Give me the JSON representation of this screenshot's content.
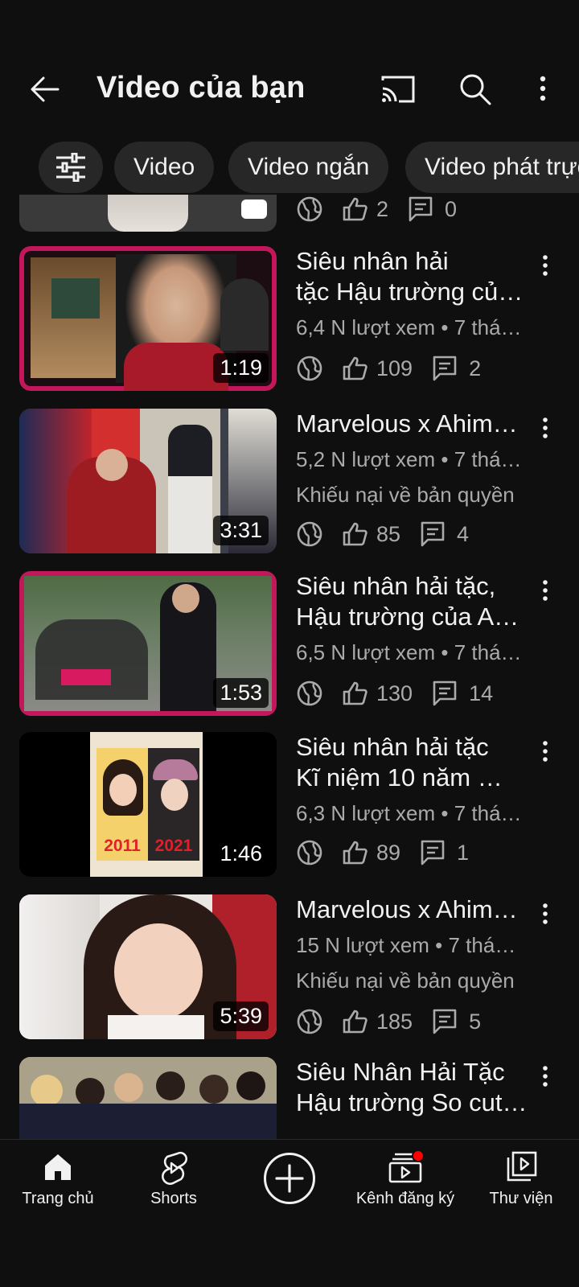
{
  "header": {
    "title": "Video của bạn",
    "back_icon": "arrow-left-icon",
    "cast_icon": "cast-icon",
    "search_icon": "search-icon",
    "more_icon": "more-vert-icon"
  },
  "filters": {
    "filter_icon": "tune-icon",
    "chips": [
      "Video",
      "Video ngắn",
      "Video phát trực tiếp"
    ]
  },
  "partial_row": {
    "likes": "2",
    "comments": "0"
  },
  "videos": [
    {
      "title_line1": "Siêu nhân hải",
      "title_line2": "tặc Hậu trường củ…",
      "meta": "6,4 N lượt xem • 7 thá…",
      "claim": "",
      "duration": "1:19",
      "likes": "109",
      "comments": "2"
    },
    {
      "title_line1": "Marvelous x Ahim…",
      "title_line2": "",
      "meta": "5,2 N lượt xem • 7 thá…",
      "claim": "Khiếu nại về bản quyền",
      "duration": "3:31",
      "likes": "85",
      "comments": "4"
    },
    {
      "title_line1": "Siêu nhân hải tặc,",
      "title_line2": "Hậu trường của Ah…",
      "meta": "6,5 N lượt xem • 7 thá…",
      "claim": "",
      "duration": "1:53",
      "likes": "130",
      "comments": "14"
    },
    {
      "title_line1": "Siêu nhân hải tặc",
      "title_line2": "Kĩ niệm 10 năm 💋…",
      "meta": "6,3 N lượt xem • 7 thá…",
      "claim": "",
      "duration": "1:46",
      "likes": "89",
      "comments": "1",
      "thumb_left_year": "2011",
      "thumb_right_year": "2021"
    },
    {
      "title_line1": "Marvelous x Ahim…",
      "title_line2": "",
      "meta": "15 N lượt xem • 7 thá…",
      "claim": "Khiếu nại về bản quyền",
      "duration": "5:39",
      "likes": "185",
      "comments": "5"
    },
    {
      "title_line1": "Siêu Nhân Hải Tặc",
      "title_line2": "Hậu trường So cut…",
      "meta": "",
      "claim": "",
      "duration": "",
      "likes": "",
      "comments": ""
    }
  ],
  "nav": {
    "home": "Trang chủ",
    "shorts": "Shorts",
    "subscriptions": "Kênh đăng ký",
    "library": "Thư viện"
  },
  "colors": {
    "background": "#0f0f0f",
    "chip": "#272727",
    "secondary_text": "#aaaaaa",
    "notification": "#ff0000"
  }
}
